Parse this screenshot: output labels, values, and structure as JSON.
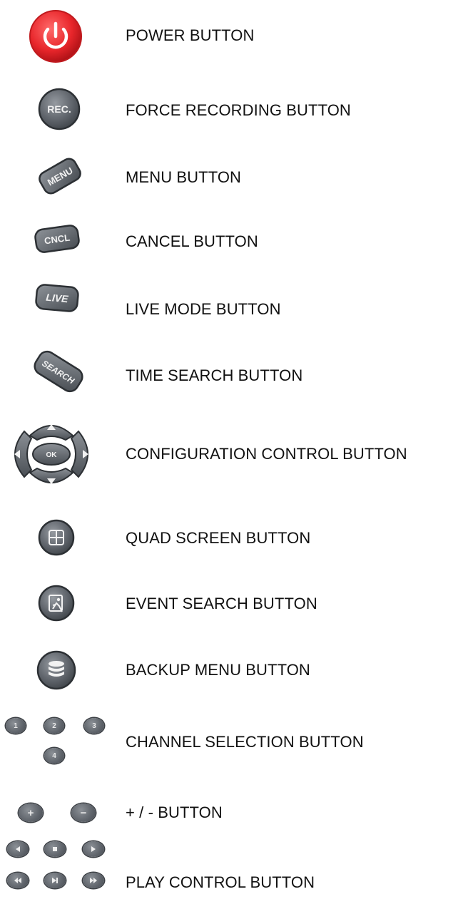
{
  "buttons": [
    {
      "id": "power",
      "label": "POWER BUTTON",
      "icon": "power-icon"
    },
    {
      "id": "rec",
      "label": "FORCE RECORDING BUTTON",
      "icon": "rec-icon",
      "icon_text": "REC."
    },
    {
      "id": "menu",
      "label": "MENU BUTTON",
      "icon": "menu-icon",
      "icon_text": "MENU"
    },
    {
      "id": "cancel",
      "label": "CANCEL BUTTON",
      "icon": "cancel-icon",
      "icon_text": "CNCL"
    },
    {
      "id": "live",
      "label": "LIVE MODE BUTTON",
      "icon": "live-icon",
      "icon_text": "LIVE"
    },
    {
      "id": "search",
      "label": "TIME SEARCH BUTTON",
      "icon": "search-icon",
      "icon_text": "SEARCH"
    },
    {
      "id": "config",
      "label": "CONFIGURATION CONTROL BUTTON",
      "icon": "direction-pad-icon",
      "icon_text": "OK"
    },
    {
      "id": "quad",
      "label": "QUAD SCREEN BUTTON",
      "icon": "quad-screen-icon"
    },
    {
      "id": "event",
      "label": "EVENT SEARCH BUTTON",
      "icon": "event-search-icon"
    },
    {
      "id": "backup",
      "label": "BACKUP MENU BUTTON",
      "icon": "database-icon"
    },
    {
      "id": "channel",
      "label": "CHANNEL SELECTION BUTTON",
      "icon": "channel-buttons-icon",
      "channels": [
        "1",
        "2",
        "3",
        "4"
      ]
    },
    {
      "id": "plusminus",
      "label": "+ / - BUTTON",
      "icon": "plus-minus-icon",
      "symbols": [
        "+",
        "−"
      ]
    },
    {
      "id": "play",
      "label": "PLAY CONTROL BUTTON",
      "icon": "play-controls-icon"
    }
  ],
  "colors": {
    "power": "#e8262b",
    "button_gray": "#5e636a",
    "text": "#111111"
  }
}
